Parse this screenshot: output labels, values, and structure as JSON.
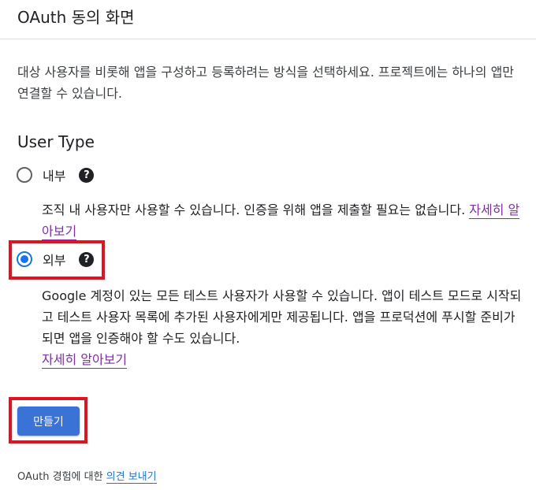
{
  "header": {
    "title": "OAuth 동의 화면"
  },
  "description": "대상 사용자를 비롯해 앱을 구성하고 등록하려는 방식을 선택하세요. 프로젝트에는 하나의 앱만 연결할 수 있습니다.",
  "user_type": {
    "title": "User Type",
    "options": [
      {
        "label": "내부",
        "selected": false,
        "description": "조직 내 사용자만 사용할 수 있습니다. 인증을 위해 앱을 제출할 필요는 없습니다. ",
        "link": "자세히 알아보기"
      },
      {
        "label": "외부",
        "selected": true,
        "description": "Google 계정이 있는 모든 테스트 사용자가 사용할 수 있습니다. 앱이 테스트 모드로 시작되고 테스트 사용자 목록에 추가된 사용자에게만 제공됩니다. 앱을 프로덕션에 푸시할 준비가 되면 앱을 인증해야 할 수도 있습니다.",
        "link": "자세히 알아보기"
      }
    ],
    "help_icon": "question-circle-icon"
  },
  "actions": {
    "create_label": "만들기"
  },
  "feedback": {
    "prefix": "OAuth 경험에 대한 ",
    "link": "의견 보내기"
  },
  "colors": {
    "accent": "#1a73e8",
    "button": "#3a72d6",
    "highlight": "#e0131f",
    "link_visited": "#7b2ea8"
  }
}
